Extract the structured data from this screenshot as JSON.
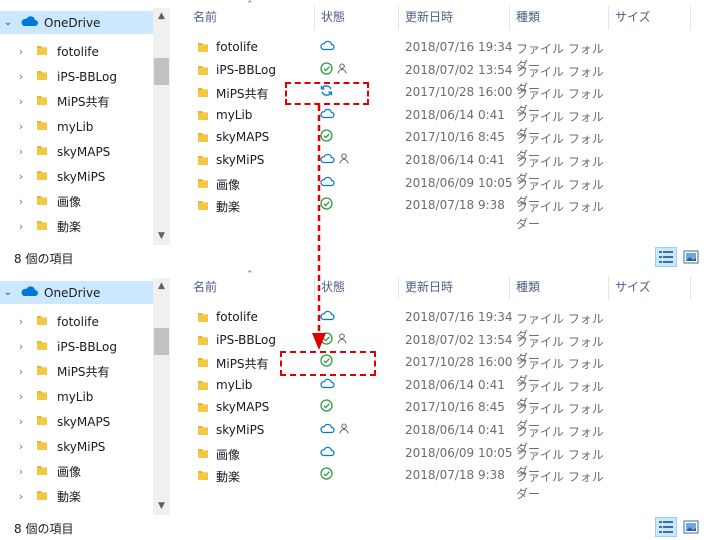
{
  "nav": {
    "root_label": "OneDrive",
    "items": [
      "fotolife",
      "iPS-BBLog",
      "MiPS共有",
      "myLib",
      "skyMAPS",
      "skyMiPS",
      "画像",
      "動楽"
    ]
  },
  "columns": {
    "name": "名前",
    "status": "状態",
    "modified": "更新日時",
    "type": "種類",
    "size": "サイズ"
  },
  "status_bar": "8 個の項目",
  "top_rows": [
    {
      "name": "fotolife",
      "status": "cloud",
      "shared": false,
      "date": "2018/07/16 19:34",
      "type": "ファイル フォルダー"
    },
    {
      "name": "iPS-BBLog",
      "status": "check",
      "shared": true,
      "date": "2018/07/02 13:54",
      "type": "ファイル フォルダー"
    },
    {
      "name": "MiPS共有",
      "status": "sync",
      "shared": false,
      "date": "2017/10/28 16:00",
      "type": "ファイル フォルダー"
    },
    {
      "name": "myLib",
      "status": "cloud",
      "shared": false,
      "date": "2018/06/14 0:41",
      "type": "ファイル フォルダー"
    },
    {
      "name": "skyMAPS",
      "status": "check",
      "shared": false,
      "date": "2017/10/16 8:45",
      "type": "ファイル フォルダー"
    },
    {
      "name": "skyMiPS",
      "status": "cloud",
      "shared": true,
      "date": "2018/06/14 0:41",
      "type": "ファイル フォルダー"
    },
    {
      "name": "画像",
      "status": "cloud",
      "shared": false,
      "date": "2018/06/09 10:05",
      "type": "ファイル フォルダー"
    },
    {
      "name": "動楽",
      "status": "check",
      "shared": false,
      "date": "2018/07/18 9:38",
      "type": "ファイル フォルダー"
    }
  ],
  "bottom_rows": [
    {
      "name": "fotolife",
      "status": "cloud",
      "shared": false,
      "date": "2018/07/16 19:34",
      "type": "ファイル フォルダー"
    },
    {
      "name": "iPS-BBLog",
      "status": "check",
      "shared": true,
      "date": "2018/07/02 13:54",
      "type": "ファイル フォルダー"
    },
    {
      "name": "MiPS共有",
      "status": "check",
      "shared": false,
      "date": "2017/10/28 16:00",
      "type": "ファイル フォルダー"
    },
    {
      "name": "myLib",
      "status": "cloud",
      "shared": false,
      "date": "2018/06/14 0:41",
      "type": "ファイル フォルダー"
    },
    {
      "name": "skyMAPS",
      "status": "check",
      "shared": false,
      "date": "2017/10/16 8:45",
      "type": "ファイル フォルダー"
    },
    {
      "name": "skyMiPS",
      "status": "cloud",
      "shared": true,
      "date": "2018/06/14 0:41",
      "type": "ファイル フォルダー"
    },
    {
      "name": "画像",
      "status": "cloud",
      "shared": false,
      "date": "2018/06/09 10:05",
      "type": "ファイル フォルダー"
    },
    {
      "name": "動楽",
      "status": "check",
      "shared": false,
      "date": "2018/07/18 9:38",
      "type": "ファイル フォルダー"
    }
  ],
  "icons": {
    "cloud": "cloud-icon",
    "check": "check-circle-icon",
    "sync": "sync-icon",
    "shared": "person-icon",
    "folder": "folder-icon",
    "onedrive": "onedrive-cloud-icon"
  },
  "colors": {
    "onedrive_blue": "#0078d7",
    "check_green": "#2f9e44",
    "highlight_red": "#e00000",
    "folder_yellow": "#f5c842",
    "selection": "#cce8ff"
  }
}
